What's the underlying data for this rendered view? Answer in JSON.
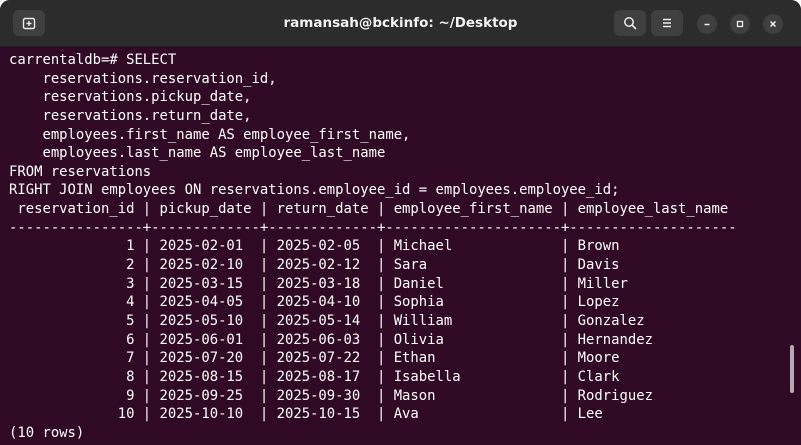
{
  "window": {
    "title": "ramansah@bckinfo: ~/Desktop",
    "colors": {
      "terminal_bg": "#300a24",
      "titlebar_bg": "#2c2c2c",
      "text": "#ffffff"
    },
    "icons": {
      "new_tab": "new-tab-icon",
      "search": "search-icon",
      "menu": "hamburger-menu-icon",
      "minimize": "minimize-icon",
      "maximize": "maximize-icon",
      "close": "close-icon"
    }
  },
  "terminal": {
    "lines": [
      "carrentaldb=# SELECT",
      "    reservations.reservation_id,",
      "    reservations.pickup_date,",
      "    reservations.return_date,",
      "    employees.first_name AS employee_first_name,",
      "    employees.last_name AS employee_last_name",
      "FROM reservations",
      "RIGHT JOIN employees ON reservations.employee_id = employees.employee_id;",
      " reservation_id | pickup_date | return_date | employee_first_name | employee_last_name",
      "----------------+-------------+-------------+---------------------+--------------------",
      "              1 | 2025-02-01  | 2025-02-05  | Michael             | Brown",
      "              2 | 2025-02-10  | 2025-02-12  | Sara                | Davis",
      "              3 | 2025-03-15  | 2025-03-18  | Daniel              | Miller",
      "              4 | 2025-04-05  | 2025-04-10  | Sophia              | Lopez",
      "              5 | 2025-05-10  | 2025-05-14  | William             | Gonzalez",
      "              6 | 2025-06-01  | 2025-06-03  | Olivia              | Hernandez",
      "              7 | 2025-07-20  | 2025-07-22  | Ethan               | Moore",
      "              8 | 2025-08-15  | 2025-08-17  | Isabella            | Clark",
      "              9 | 2025-09-25  | 2025-09-30  | Mason               | Rodriguez",
      "             10 | 2025-10-10  | 2025-10-15  | Ava                 | Lee",
      "(10 rows)"
    ]
  }
}
